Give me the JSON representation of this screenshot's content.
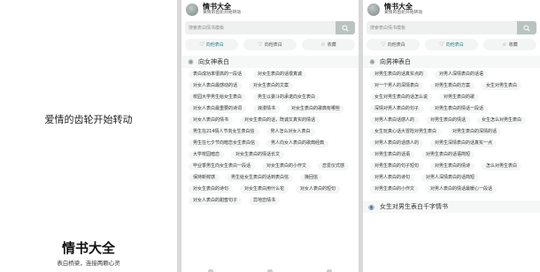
{
  "splash": {
    "tagline": "爱情的齿轮开始转动",
    "app_name": "情书大全",
    "slogan": "表白桥梁，连接两颗心灵"
  },
  "app": {
    "title": "情书大全",
    "subtitle": "爱情的齿轮开始转动"
  },
  "search": {
    "placeholder": "搜索表白情书模板"
  },
  "tabs": [
    {
      "label": "向他表白",
      "icon": "heart-icon"
    },
    {
      "label": "向他表白",
      "icon": "heart-icon"
    },
    {
      "label": "收藏",
      "icon": "star-icon"
    }
  ],
  "left_panel": {
    "active_tab": 0,
    "section_title": "向女神表白",
    "section_icon": "sun-icon",
    "tags": [
      "表白成功率很高的一段话",
      "对女生表白的话很真诚",
      "对女人表白最感动的话",
      "对女生表白的文案",
      "校园大学男生给女生表白",
      "男生以委斗的承诺向女生表白",
      "对女人表白最重要的诗词",
      "浪漫情书",
      "对女生表白的歌典有哪些",
      "对女人表白的情书",
      "对女生表白的话，既诚又真实的情话",
      "男生在214情人节向女生表白信",
      "男人怎么对女人表白",
      "男生在七夕节向暗恋女生表白信",
      "男人向女人表白的歌典经典",
      "大学校园暗恋",
      "对女生表白的情话长文",
      "毕业季男生向女生表白一段话",
      "对女生表白的小作文",
      "恋爱仪式感",
      "保持新鲜感",
      "男生给女生表白的话到表白信",
      "挽回信",
      "对女生表白的诗句",
      "对女生表白用什么花",
      "对女人表白的短句",
      "对女人表白的甜蜜句子",
      "异地恋情书"
    ]
  },
  "right_panel": {
    "active_tab": 1,
    "section_title": "向男神表白",
    "section_icon": "sun-icon",
    "tags": [
      "对男生表白的话真实点的",
      "对男人深情表白的话语",
      "对一个男人的深情表白",
      "对男生表白的方案",
      "女生对男生表白",
      "女生对男生表白的话怎么说",
      "对男生表白的歌",
      "深情对男人表白的句子",
      "对男生表白的情话一段话",
      "对男人表白话感人的",
      "对男生表白的情话",
      "女生怎么对男生表白",
      "女生玩真心话大冒险对男生表白",
      "对男生表白的深情的话",
      "对男人表白的话感人的",
      "对男生深情表白的话真实一点",
      "对男生表白的话语",
      "对男生表白的话语简短",
      "对男生表白的句子短句",
      "对男生表白的情诗",
      "怎么对男生表白",
      "对男人表白的诗句",
      "对男人深情表白的话简短",
      "对男生表白的小作文",
      "对男人表白的情话最暖心一段话"
    ],
    "section2_title": "女生对男生表白千字情书",
    "section2_icon": "globe-icon"
  },
  "colors": {
    "accent": "#2a7f8a",
    "tag_bg": "#f4f5f5",
    "search_btn": "#b9c4c1"
  }
}
